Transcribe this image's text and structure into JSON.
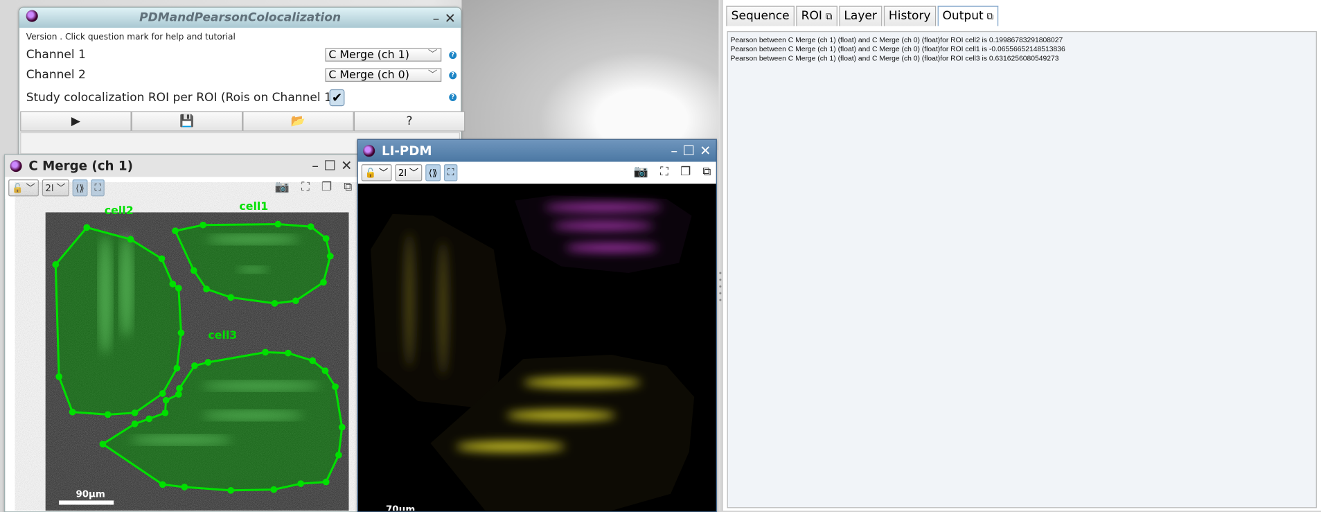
{
  "plugin": {
    "title": "PDMandPearsonColocalization",
    "version_text": "Version . Click question mark for help and tutorial",
    "channel1_label": "Channel 1",
    "channel1_value": "C Merge (ch 1)",
    "channel2_label": "Channel 2",
    "channel2_value": "C Merge (ch 0)",
    "study_label": "Study colocalization ROI per ROI (Rois on Channel 1)",
    "study_checked": true,
    "help_glyph": "?",
    "buttons": {
      "run": "▶",
      "save": "💾",
      "open": "📂",
      "help": "?"
    }
  },
  "viewer1": {
    "title": "C Merge (ch 1)",
    "mode": "2l",
    "scale_bar": "90µm",
    "rois": [
      "cell1",
      "cell2",
      "cell3"
    ],
    "roi_color": "#00e000"
  },
  "viewer2": {
    "title": "LI-PDM",
    "mode": "2l",
    "scale_bar": "70µm"
  },
  "tabs": [
    {
      "label": "Sequence"
    },
    {
      "label": "ROI",
      "ext": "⧉"
    },
    {
      "label": "Layer"
    },
    {
      "label": "History"
    },
    {
      "label": "Output",
      "ext": "⧉",
      "active": true
    }
  ],
  "output": {
    "lines": [
      "Pearson between C Merge (ch 1) (float) and C Merge (ch 0) (float)for ROI cell2 is 0.19986783291808027",
      "Pearson between C Merge (ch 1) (float) and C Merge (ch 0) (float)for ROI cell1 is -0.06556652148513836",
      "Pearson between C Merge (ch 1) (float) and C Merge (ch 0) (float)for ROI cell3 is 0.6316256080549273"
    ]
  }
}
